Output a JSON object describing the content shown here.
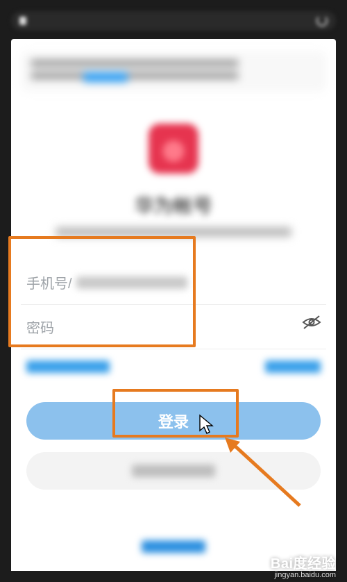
{
  "brand_title": "华为帐号",
  "fields": {
    "phone_label": "手机号/",
    "password_label": "密码"
  },
  "buttons": {
    "login": "登录"
  },
  "watermark": {
    "brand": "Bai度经验",
    "url": "jingyan.baidu.com"
  },
  "colors": {
    "highlight": "#e67a1f",
    "primary_button": "#8cc1ed"
  }
}
